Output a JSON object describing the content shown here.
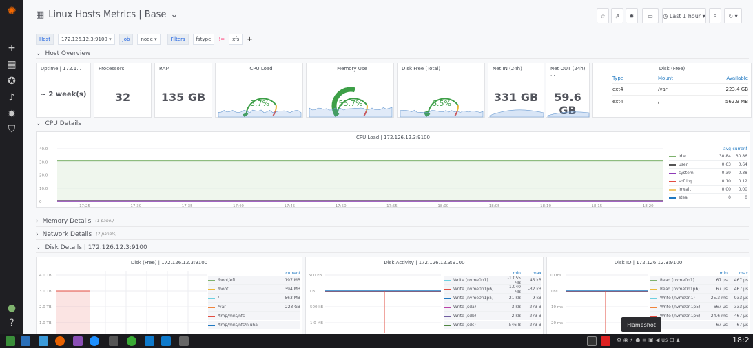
{
  "dashboard": {
    "title": "Linux Hosts Metrics | Base"
  },
  "toolbar": {
    "time": "Last 1 hour"
  },
  "vars": {
    "host_label": "Host",
    "host_value": "172.126.12.3:9100",
    "job_label": "Job",
    "job_value": "node",
    "filters_label": "Filters",
    "filter_key": "fstype",
    "filter_op": "!=",
    "filter_val": "xfs",
    "add": "+"
  },
  "rows": {
    "host_overview": "Host Overview",
    "cpu_details": "CPU Details",
    "memory": "Memory Details",
    "memory_n": "(1 panel)",
    "network": "Network Details",
    "network_n": "(2 panels)",
    "disk": "Disk Details | 172.126.12.3:9100"
  },
  "stats": [
    {
      "title": "Uptime | 172.1...",
      "value": "~  2 week(s)"
    },
    {
      "title": "Processors",
      "value": "32"
    },
    {
      "title": "RAM",
      "value": "135 GB"
    },
    {
      "title": "CPU Load",
      "value": "3.7%",
      "level": 3.7
    },
    {
      "title": "Memory Use",
      "value": "55.7%",
      "level": 55.7
    },
    {
      "title": "Disk Free (Total)",
      "value": "6.5%",
      "level": 6.5
    },
    {
      "title": "Net IN (24h)",
      "value": "331 GB"
    },
    {
      "title": "Net OUT (24h) ...",
      "value": "59.6 GB"
    }
  ],
  "diskfree": {
    "title": "Disk (Free)",
    "h": [
      "Type",
      "Mount",
      "Available"
    ],
    "r": [
      [
        "ext4",
        "/var",
        "223.4 GB"
      ],
      [
        "ext4",
        "/",
        "562.9 MB"
      ]
    ]
  },
  "cpuload": {
    "title": "CPU Load | 172.126.12.3:9100",
    "yt": [
      "40.0",
      "30.0",
      "20.0",
      "10.0",
      "0"
    ],
    "xt": [
      "17:25",
      "17:30",
      "17:35",
      "17:40",
      "17:45",
      "17:50",
      "17:55",
      "18:00",
      "18:05",
      "18:10",
      "18:15",
      "18:20"
    ],
    "legend_h": [
      "avg",
      "current"
    ],
    "legend": [
      [
        "idle",
        "30.84",
        "30.86",
        "#7eb26d"
      ],
      [
        "user",
        "0.63",
        "0.64",
        "#555"
      ],
      [
        "system",
        "0.39",
        "0.38",
        "#8f3bb8"
      ],
      [
        "softirq",
        "0.10",
        "0.12",
        "#e24d42"
      ],
      [
        "iowait",
        "0.00",
        "0.00",
        "#f2c96d"
      ],
      [
        "steal",
        "0",
        "0",
        "#1f78c1"
      ]
    ]
  },
  "diskfreep": {
    "title": "Disk (Free) | 172.126.12.3:9100",
    "yt": [
      "4.0 TB",
      "3.0 TB",
      "2.0 TB",
      "1.0 TB"
    ],
    "h": "current",
    "legend": [
      [
        "/boot/efi",
        "197 MB",
        "#7eb26d"
      ],
      [
        "/boot",
        "394 MB",
        "#eab839"
      ],
      [
        "/",
        "563 MB",
        "#6ed0e0"
      ],
      [
        "/var",
        "223 GB",
        "#ef843c"
      ],
      [
        "/tmp/mnt/nfs",
        "",
        "#e24d42"
      ],
      [
        "/tmp/mnt/nfs/nluha",
        "",
        "#1f78c1"
      ]
    ]
  },
  "diskact": {
    "title": "Disk Activity | 172.126.12.3:9100",
    "yt": [
      "500 kB",
      "0 B",
      "-500 kB",
      "-1.0 MB"
    ],
    "h": [
      "min",
      "max"
    ],
    "legend": [
      [
        "Write (nvme0n1)",
        "-1.055 MB",
        "45 kB",
        "#6ed0e0"
      ],
      [
        "Write (nvme0n1p6)",
        "-1.040 MB",
        "-32 kB",
        "#e24d42"
      ],
      [
        "Write (nvme0n1p5)",
        "-21 kB",
        "-9 kB",
        "#1f78c1"
      ],
      [
        "Write (sda)",
        "-3 kB",
        "-273 B",
        "#ba43a9"
      ],
      [
        "Write (sdb)",
        "-2 kB",
        "-273 B",
        "#705da0"
      ],
      [
        "Write (sdc)",
        "-546 B",
        "-273 B",
        "#508642"
      ]
    ]
  },
  "diskio": {
    "title": "Disk IO | 172.126.12.3:9100",
    "yt": [
      "10 ms",
      "0 ns",
      "-10 ms",
      "-20 ms"
    ],
    "h": [
      "min",
      "max"
    ],
    "legend": [
      [
        "Read (nvme0n1)",
        "67 µs",
        "467 µs",
        "#7eb26d"
      ],
      [
        "Read (nvme0n1p6)",
        "67 µs",
        "467 µs",
        "#eab839"
      ],
      [
        "Write (nvme0n1)",
        "-25.3 ms",
        "-933 µs",
        "#6ed0e0"
      ],
      [
        "Write (nvme0n1p5)",
        "-667 µs",
        "-333 µs",
        "#ef843c"
      ],
      [
        "Write (nvme0n1p6)",
        "-24.6 ms",
        "-467 µs",
        "#e24d42"
      ],
      [
        "",
        "-67 µs",
        "-67 µs",
        "#1f78c1"
      ]
    ]
  },
  "flameshot": "Flameshot",
  "clock": "18:2"
}
